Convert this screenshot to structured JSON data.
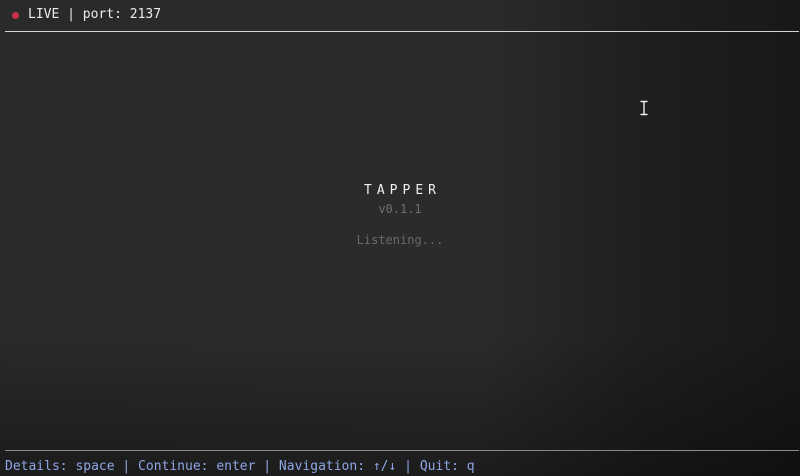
{
  "header": {
    "status_text": "LIVE | port: 2137"
  },
  "app": {
    "name": "TAPPER",
    "version": "v0.1.1",
    "status": "Listening..."
  },
  "footer": {
    "help_text": "Details: space | Continue: enter | Navigation: ↑/↓ | Quit: q"
  },
  "colors": {
    "live_indicator": "#c9334a",
    "help_text": "#8ea6e6"
  },
  "icons": {
    "live_indicator": "dot",
    "mouse_cursor": "text-i-beam-cursor"
  }
}
